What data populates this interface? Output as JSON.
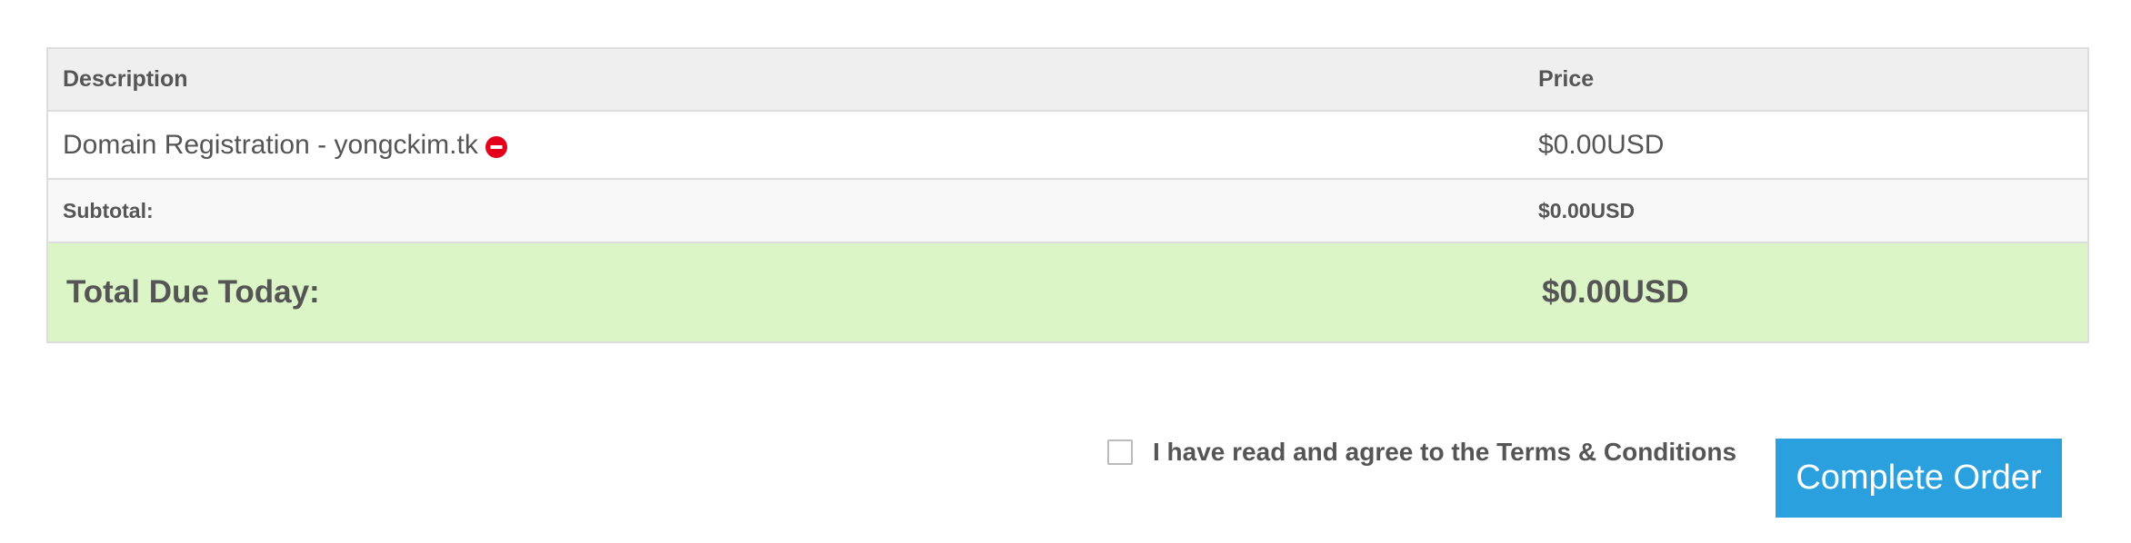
{
  "table": {
    "header": {
      "description": "Description",
      "price": "Price"
    },
    "items": [
      {
        "description": "Domain Registration - yongckim.tk",
        "price": "$0.00USD",
        "remove_icon": "minus-circle-icon"
      }
    ],
    "subtotal": {
      "label": "Subtotal:",
      "value": "$0.00USD"
    },
    "total": {
      "label": "Total Due Today:",
      "value": "$0.00USD"
    }
  },
  "terms": {
    "text_prefix": "I have read and agree to the ",
    "link_text": "Terms & Conditions",
    "checked": false
  },
  "actions": {
    "complete_order_label": "Complete Order"
  },
  "colors": {
    "accent_button": "#2aa1de",
    "total_row_bg": "#dbf5c7",
    "remove_icon": "#e3001b",
    "header_bg": "#efefef"
  }
}
